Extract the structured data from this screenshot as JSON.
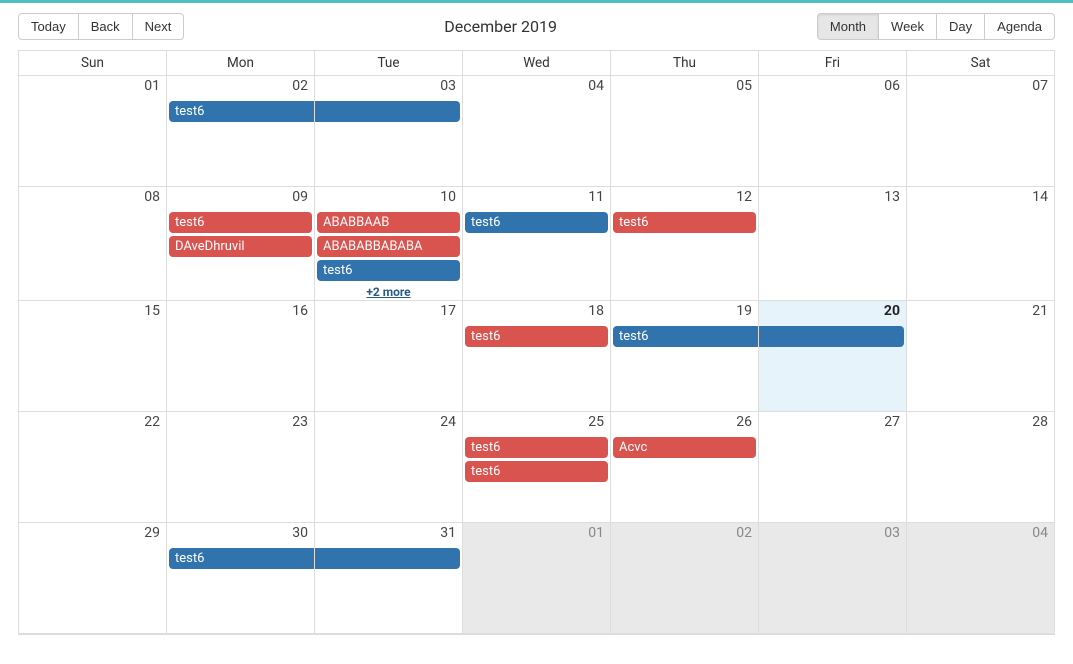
{
  "toolbar": {
    "today": "Today",
    "back": "Back",
    "next": "Next",
    "title": "December 2019",
    "views": {
      "month": "Month",
      "week": "Week",
      "day": "Day",
      "agenda": "Agenda"
    }
  },
  "dayHeaders": [
    "Sun",
    "Mon",
    "Tue",
    "Wed",
    "Thu",
    "Fri",
    "Sat"
  ],
  "colors": {
    "primary_blue": "#3174ad",
    "primary_red": "#d9534f",
    "today_bg": "#e6f3fb"
  },
  "grid": {
    "weeks": [
      {
        "days": [
          {
            "num": "01"
          },
          {
            "num": "02",
            "events": [
              {
                "label": "test6",
                "color": "blue",
                "contRight": true
              }
            ]
          },
          {
            "num": "03",
            "events": [
              {
                "label": "",
                "color": "blue",
                "contLeft": true
              }
            ]
          },
          {
            "num": "04"
          },
          {
            "num": "05"
          },
          {
            "num": "06"
          },
          {
            "num": "07"
          }
        ]
      },
      {
        "days": [
          {
            "num": "08"
          },
          {
            "num": "09",
            "events": [
              {
                "label": "test6",
                "color": "red"
              },
              {
                "label": "DAveDhruvil",
                "color": "red"
              }
            ]
          },
          {
            "num": "10",
            "events": [
              {
                "label": "ABABBAAB",
                "color": "red"
              },
              {
                "label": "ABABABBABABA",
                "color": "red"
              },
              {
                "label": "test6",
                "color": "blue"
              }
            ],
            "more": "+2 more"
          },
          {
            "num": "11",
            "events": [
              {
                "label": "test6",
                "color": "blue"
              }
            ]
          },
          {
            "num": "12",
            "events": [
              {
                "label": "test6",
                "color": "red"
              }
            ]
          },
          {
            "num": "13"
          },
          {
            "num": "14"
          }
        ]
      },
      {
        "days": [
          {
            "num": "15"
          },
          {
            "num": "16"
          },
          {
            "num": "17"
          },
          {
            "num": "18",
            "events": [
              {
                "label": "test6",
                "color": "red"
              }
            ]
          },
          {
            "num": "19",
            "events": [
              {
                "label": "test6",
                "color": "blue",
                "contRight": true
              }
            ]
          },
          {
            "num": "20",
            "today": true,
            "events": [
              {
                "label": "",
                "color": "blue",
                "contLeft": true
              }
            ]
          },
          {
            "num": "21"
          }
        ]
      },
      {
        "days": [
          {
            "num": "22"
          },
          {
            "num": "23"
          },
          {
            "num": "24"
          },
          {
            "num": "25",
            "events": [
              {
                "label": "test6",
                "color": "red"
              },
              {
                "label": "test6",
                "color": "red"
              }
            ]
          },
          {
            "num": "26",
            "events": [
              {
                "label": "Acvc",
                "color": "red"
              }
            ]
          },
          {
            "num": "27"
          },
          {
            "num": "28"
          }
        ]
      },
      {
        "days": [
          {
            "num": "29"
          },
          {
            "num": "30",
            "events": [
              {
                "label": "test6",
                "color": "blue",
                "contRight": true
              }
            ]
          },
          {
            "num": "31",
            "events": [
              {
                "label": "",
                "color": "blue",
                "contLeft": true
              }
            ]
          },
          {
            "num": "01",
            "off": true
          },
          {
            "num": "02",
            "off": true
          },
          {
            "num": "03",
            "off": true
          },
          {
            "num": "04",
            "off": true
          }
        ]
      }
    ]
  }
}
